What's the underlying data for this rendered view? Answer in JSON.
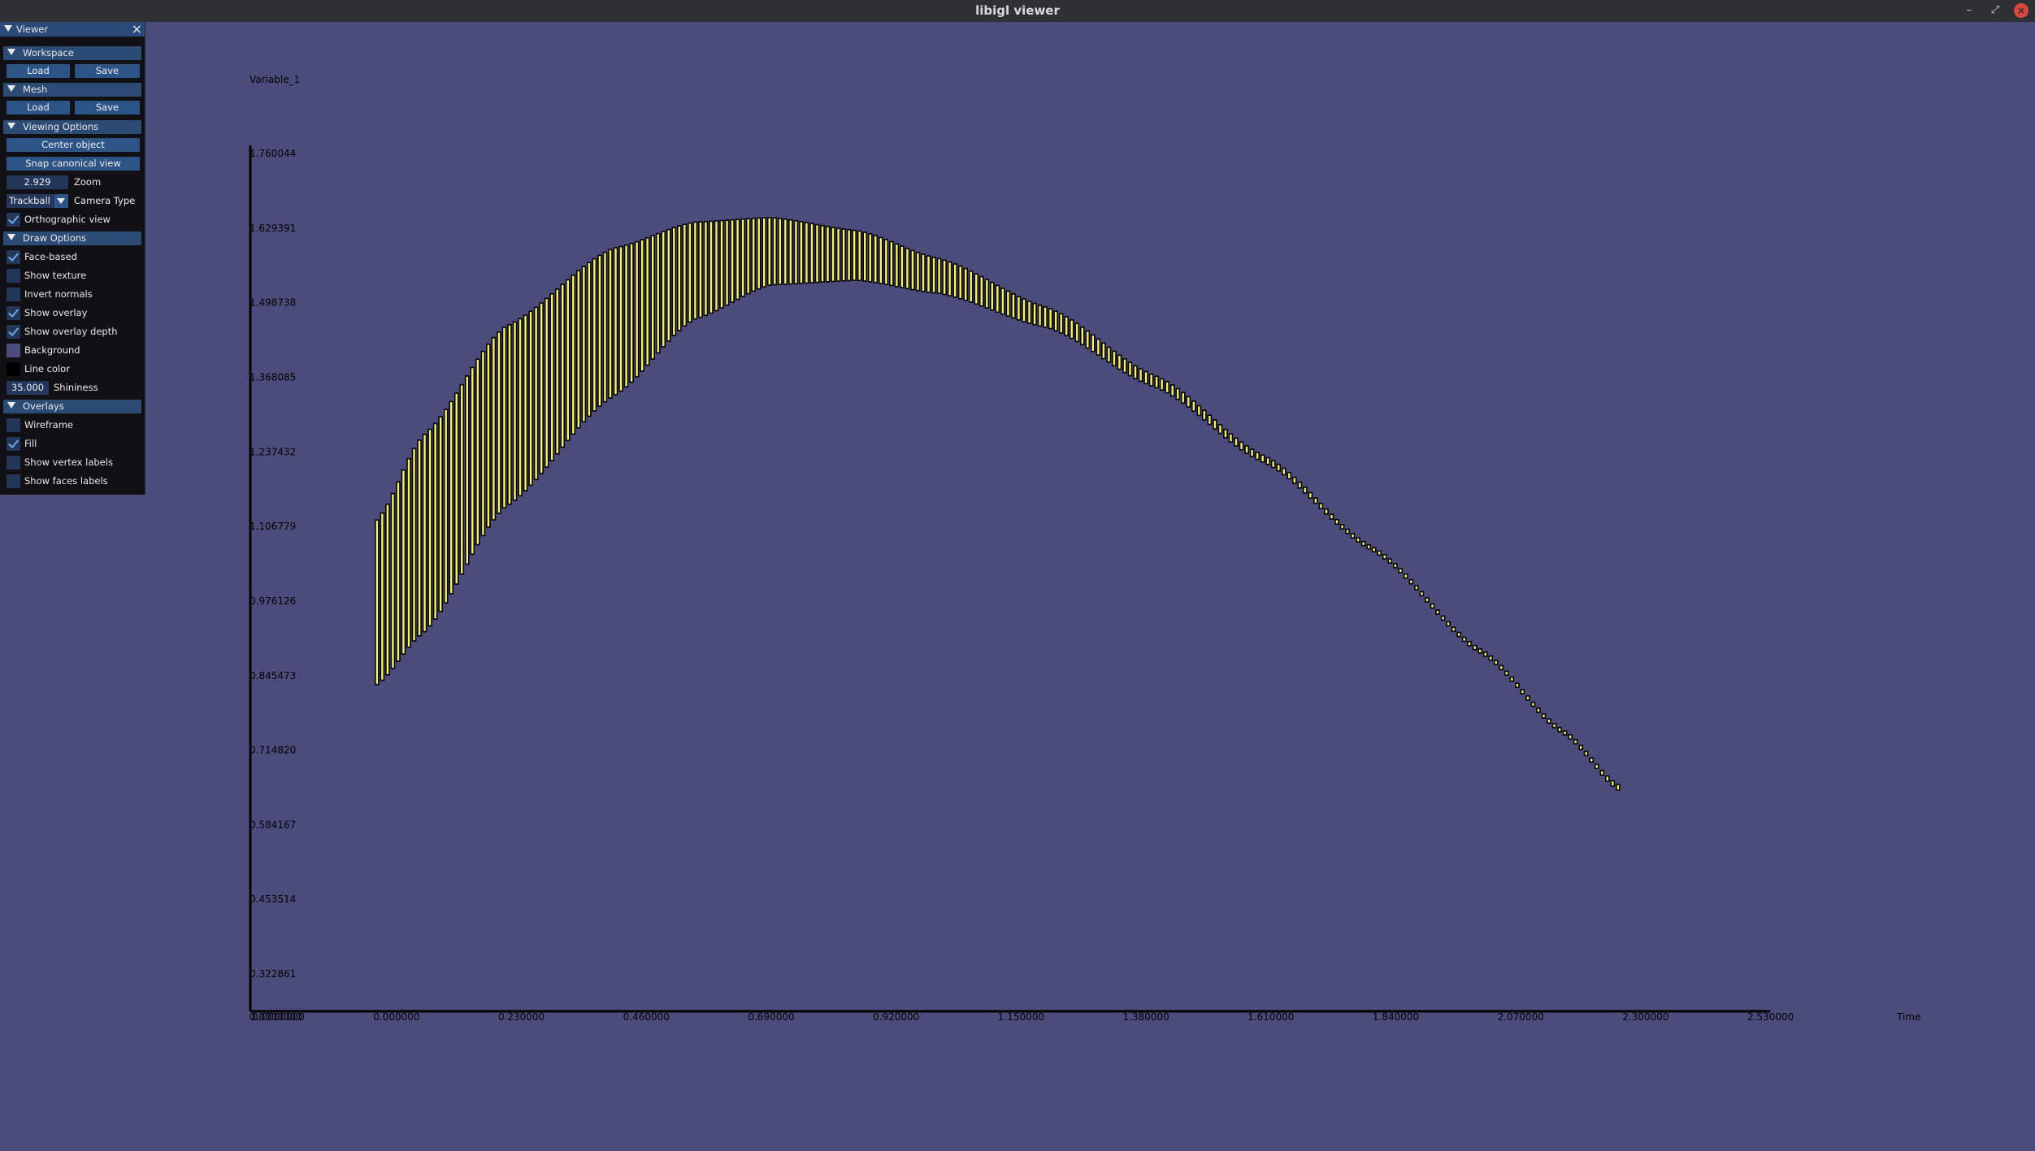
{
  "window": {
    "title": "libigl viewer",
    "minimize": "–",
    "restore": "⤢",
    "close": "×"
  },
  "panel": {
    "title": "Viewer",
    "close_icon": "close-icon",
    "sections": {
      "workspace": {
        "label": "Workspace",
        "load": "Load",
        "save": "Save"
      },
      "mesh": {
        "label": "Mesh",
        "load": "Load",
        "save": "Save"
      },
      "viewing": {
        "label": "Viewing Options",
        "center": "Center object",
        "snap": "Snap canonical view",
        "zoom_value": "2.929",
        "zoom_label": "Zoom",
        "camera_value": "Trackball",
        "camera_label": "Camera Type",
        "ortho_label": "Orthographic view",
        "ortho_checked": true
      },
      "draw": {
        "label": "Draw Options",
        "face_based": "Face-based",
        "show_texture": "Show texture",
        "invert_normals": "Invert normals",
        "show_overlay": "Show overlay",
        "show_overlay_depth": "Show overlay depth",
        "background": "Background",
        "background_color": "#4b4c7c",
        "line_color": "Line color",
        "line_color_value": "#000000",
        "shininess_value": "35.000",
        "shininess_label": "Shininess"
      },
      "overlays": {
        "label": "Overlays",
        "wireframe": "Wireframe",
        "fill": "Fill",
        "vertex_labels": "Show vertex labels",
        "faces_labels": "Show faces labels"
      }
    }
  },
  "chart_data": {
    "type": "bar",
    "ylabel": "Variable_1",
    "xlabel": "Time",
    "y_ticks": [
      "1.760044",
      "1.629391",
      "1.498738",
      "1.368085",
      "1.237432",
      "1.106779",
      "0.976126",
      "0.845473",
      "0.714820",
      "0.584167",
      "0.453514",
      "0.322861"
    ],
    "x_ticks": [
      "0.000000",
      "0.230000",
      "0.460000",
      "0.690000",
      "0.920000",
      "1.150000",
      "1.380000",
      "1.610000",
      "1.840000",
      "2.070000",
      "2.300000",
      "2.530000"
    ],
    "ylim": [
      0.2575,
      1.760044
    ],
    "xlim": [
      -0.2682,
      2.53
    ],
    "bar_color": "#f6f35e",
    "edge_color": "#000000",
    "band": {
      "x_start": -0.035,
      "x_end": 2.25,
      "count": 235,
      "upper": [
        [
          -0.035,
          1.118
        ],
        [
          0.05,
          1.266
        ],
        [
          0.2,
          1.456
        ],
        [
          0.4,
          1.594
        ],
        [
          0.55,
          1.64
        ],
        [
          0.69,
          1.648
        ],
        [
          0.85,
          1.625
        ],
        [
          1.0,
          1.576
        ],
        [
          1.2,
          1.49
        ],
        [
          1.4,
          1.37
        ],
        [
          1.6,
          1.23
        ],
        [
          1.8,
          1.07
        ],
        [
          2.0,
          0.89
        ],
        [
          2.15,
          0.75
        ],
        [
          2.25,
          0.655
        ]
      ],
      "lower": [
        [
          -0.035,
          0.83
        ],
        [
          0.05,
          0.92
        ],
        [
          0.2,
          1.14
        ],
        [
          0.4,
          1.335
        ],
        [
          0.55,
          1.47
        ],
        [
          0.69,
          1.53
        ],
        [
          0.85,
          1.538
        ],
        [
          1.0,
          1.515
        ],
        [
          1.2,
          1.455
        ],
        [
          1.4,
          1.35
        ],
        [
          1.6,
          1.218
        ],
        [
          1.8,
          1.064
        ],
        [
          2.0,
          0.887
        ],
        [
          2.15,
          0.748
        ],
        [
          2.25,
          0.645
        ]
      ]
    }
  }
}
